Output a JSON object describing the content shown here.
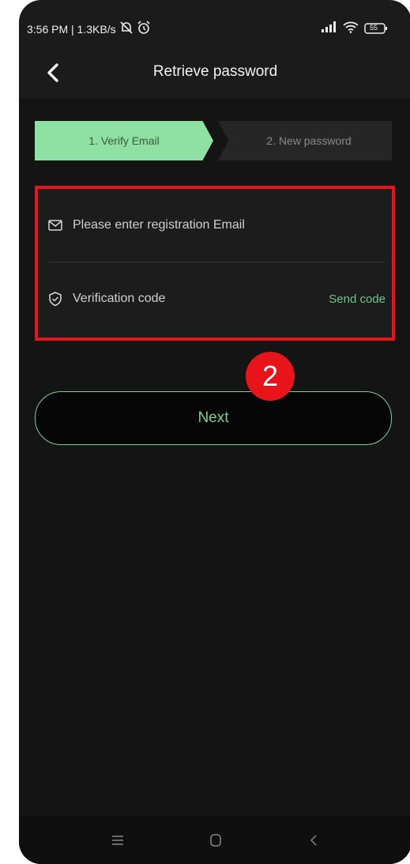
{
  "status": {
    "time_speed": "3:56 PM | 1.3KB/s",
    "battery": "55",
    "icons": [
      "mute-icon",
      "alarm-icon",
      "signal-icon",
      "wifi-icon",
      "battery-icon"
    ]
  },
  "header": {
    "title": "Retrieve password",
    "back_icon": "chevron-left-icon"
  },
  "steps": [
    {
      "label": "1. Verify Email",
      "active": true
    },
    {
      "label": "2. New password",
      "active": false
    }
  ],
  "form": {
    "email_placeholder": "Please enter registration Email",
    "email_value": "",
    "code_placeholder": "Verification code",
    "code_value": "",
    "send_code_label": "Send code"
  },
  "next_label": "Next",
  "annotation_badge": "2",
  "colors": {
    "accent": "#7ccf95",
    "step_active": "#8ee0a3",
    "highlight": "#e8141a",
    "background": "#141414"
  },
  "navbar": {
    "icons": [
      "menu-icon",
      "home-icon",
      "back-icon"
    ]
  }
}
